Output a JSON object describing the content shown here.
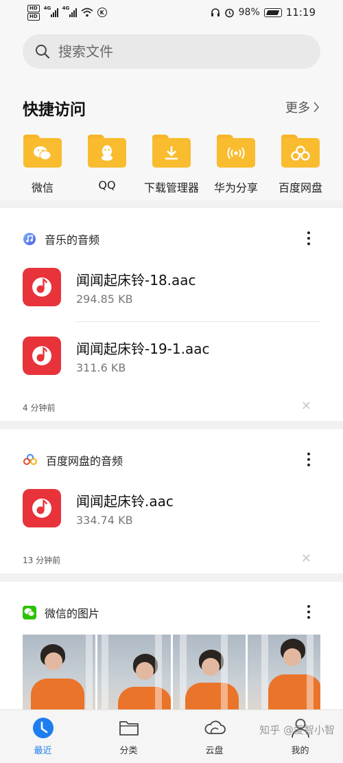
{
  "status_bar": {
    "hd1": "HD",
    "hd2": "HD",
    "net1": "4G",
    "net2": "4G",
    "k_badge": "K",
    "battery_pct": "98%",
    "time": "11:19"
  },
  "search": {
    "placeholder": "搜索文件"
  },
  "quick_access": {
    "title": "快捷访问",
    "more": "更多",
    "items": [
      {
        "label": "微信",
        "icon": "wechat-icon"
      },
      {
        "label": "QQ",
        "icon": "qq-icon"
      },
      {
        "label": "下载管理器",
        "icon": "download-icon"
      },
      {
        "label": "华为分享",
        "icon": "huawei-share-icon"
      },
      {
        "label": "百度网盘",
        "icon": "baidu-netdisk-icon"
      }
    ],
    "folder_color": "#f9bc2f"
  },
  "cards": [
    {
      "title": "音乐的音频",
      "icon": "music-app-icon",
      "files": [
        {
          "name": "闻闻起床铃-18.aac",
          "size": "294.85 KB"
        },
        {
          "name": "闻闻起床铃-19-1.aac",
          "size": "311.6 KB"
        }
      ],
      "time": "4 分钟前"
    },
    {
      "title": "百度网盘的音频",
      "icon": "baidu-netdisk-icon",
      "files": [
        {
          "name": "闻闻起床铃.aac",
          "size": "334.74 KB"
        }
      ],
      "time": "13 分钟前"
    },
    {
      "title": "微信的图片",
      "icon": "wechat-icon",
      "photo_count": 4
    }
  ],
  "bottom_nav": [
    {
      "label": "最近",
      "icon": "clock-icon",
      "active": true
    },
    {
      "label": "分类",
      "icon": "folder-icon",
      "active": false
    },
    {
      "label": "云盘",
      "icon": "cloud-icon",
      "active": false
    },
    {
      "label": "我的",
      "icon": "person-icon",
      "active": false
    }
  ],
  "watermark": "知乎 @爱智小智",
  "colors": {
    "accent": "#1e7ef0",
    "audio_icon": "#e8333a",
    "folder": "#f9bc2f",
    "wechat_green": "#2dc100"
  }
}
